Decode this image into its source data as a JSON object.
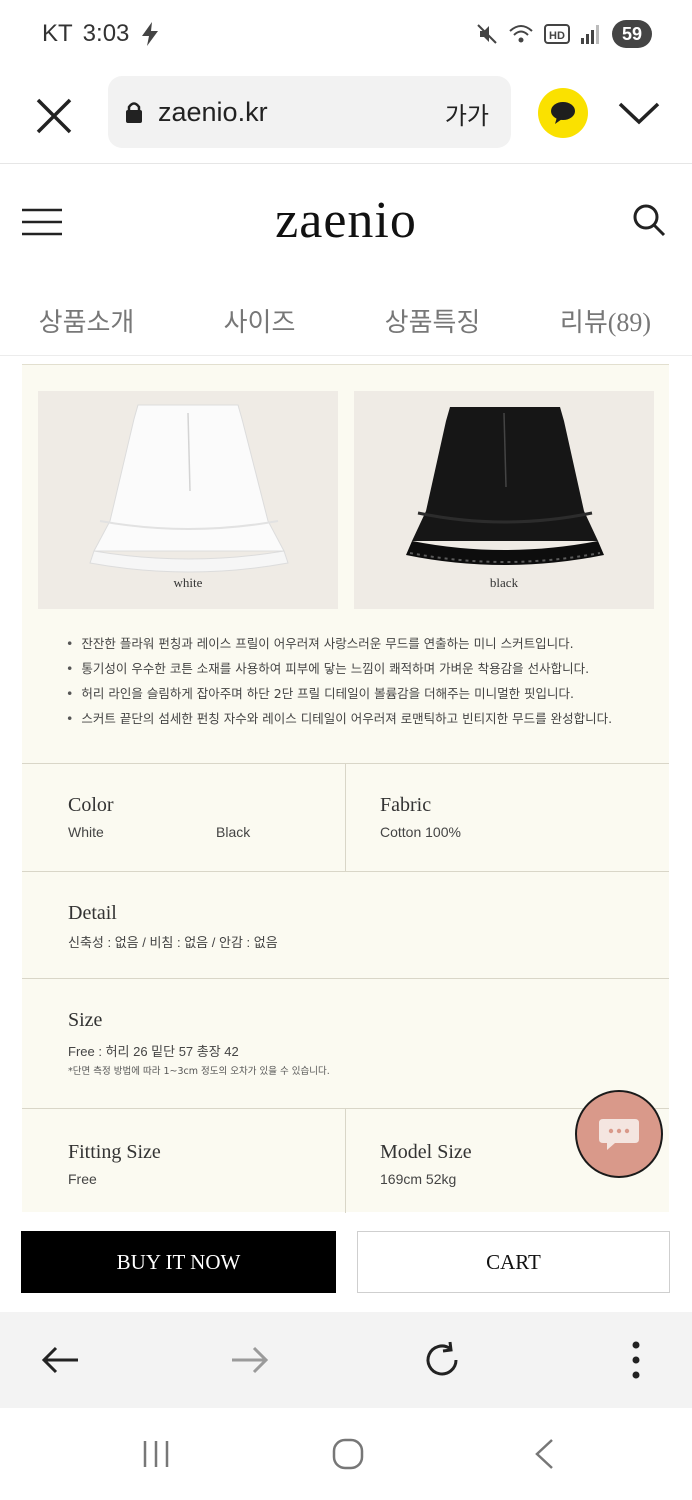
{
  "status_bar": {
    "carrier": "KT",
    "time": "3:03",
    "battery": "59"
  },
  "browser": {
    "url": "zaenio.kr",
    "font_size_label": "가가"
  },
  "site": {
    "logo": "zaenio"
  },
  "tabs": [
    {
      "label": "상품소개"
    },
    {
      "label": "사이즈"
    },
    {
      "label": "상품특징"
    },
    {
      "label": "리뷰(89)"
    }
  ],
  "product": {
    "photos": [
      {
        "caption": "white",
        "color": "#ffffff"
      },
      {
        "caption": "black",
        "color": "#111111"
      }
    ],
    "bullets": [
      "잔잔한 플라워 펀칭과 레이스 프릴이 어우러져 사랑스러운 무드를 연출하는 미니 스커트입니다.",
      "통기성이 우수한 코튼 소재를 사용하여 피부에 닿는 느낌이 쾌적하며 가벼운 착용감을 선사합니다.",
      "허리 라인을 슬림하게 잡아주며 하단 2단 프릴 디테일이 볼륨감을 더해주는 미니멀한 핏입니다.",
      "스커트 끝단의 섬세한 펀칭 자수와 레이스 디테일이 어우러져 로맨틱하고 빈티지한 무드를 완성합니다."
    ],
    "color": {
      "label": "Color",
      "values": [
        "White",
        "Black"
      ]
    },
    "fabric": {
      "label": "Fabric",
      "value": "Cotton 100%"
    },
    "detail": {
      "label": "Detail",
      "value": "신축성 : 없음 / 비침 : 없음 / 안감 : 없음"
    },
    "size": {
      "label": "Size",
      "value": "Free : 허리 26 밑단 57 총장 42",
      "note": "*단면 측정 방법에 따라 1~3cm 정도의 오차가 있을 수 있습니다."
    },
    "fitting_size": {
      "label": "Fitting Size",
      "value": "Free"
    },
    "model_size": {
      "label": "Model Size",
      "value": "169cm  52kg"
    }
  },
  "actions": {
    "buy_now": "BUY IT NOW",
    "cart": "CART"
  },
  "colors": {
    "panel_bg": "#fbfaf1",
    "kakao": "#fae100",
    "chat_fab": "#d9998a"
  }
}
